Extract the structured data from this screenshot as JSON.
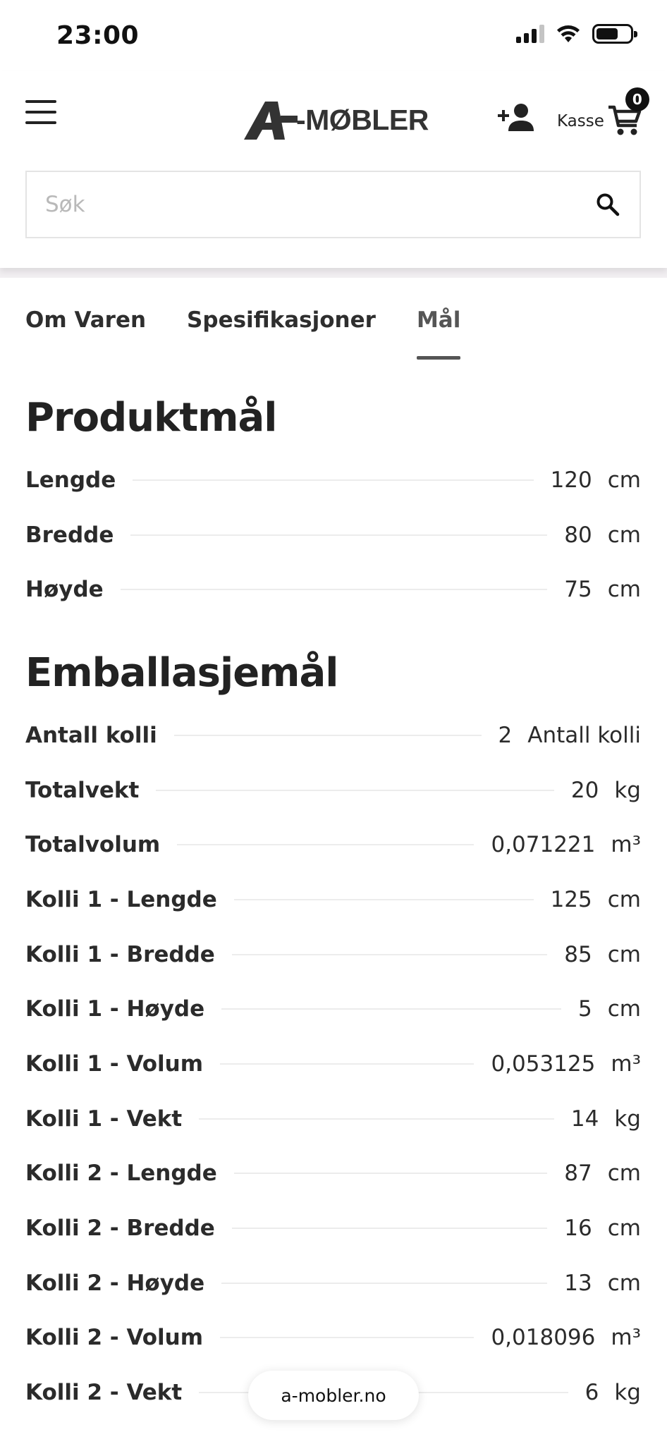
{
  "status_bar": {
    "time": "23:00"
  },
  "header": {
    "logo_text": "-MØBLER",
    "kasse_label": "Kasse",
    "cart_count": "0"
  },
  "search": {
    "placeholder": "Søk"
  },
  "tabs": [
    {
      "label": "Om Varen"
    },
    {
      "label": "Spesifikasjoner"
    },
    {
      "label": "Mål"
    }
  ],
  "active_tab": "Mål",
  "product_dimensions": {
    "title": "Produktmål",
    "rows": [
      {
        "label": "Lengde",
        "value": "120",
        "unit": "cm"
      },
      {
        "label": "Bredde",
        "value": "80",
        "unit": "cm"
      },
      {
        "label": "Høyde",
        "value": "75",
        "unit": "cm"
      }
    ]
  },
  "package_dimensions": {
    "title": "Emballasjemål",
    "rows": [
      {
        "label": "Antall kolli",
        "value": "2",
        "unit": "Antall kolli"
      },
      {
        "label": "Totalvekt",
        "value": "20",
        "unit": "kg"
      },
      {
        "label": "Totalvolum",
        "value": "0,071221",
        "unit": "m³"
      },
      {
        "label": "Kolli 1 - Lengde",
        "value": "125",
        "unit": "cm"
      },
      {
        "label": "Kolli 1 - Bredde",
        "value": "85",
        "unit": "cm"
      },
      {
        "label": "Kolli 1 - Høyde",
        "value": "5",
        "unit": "cm"
      },
      {
        "label": "Kolli 1 - Volum",
        "value": "0,053125",
        "unit": "m³"
      },
      {
        "label": "Kolli 1 - Vekt",
        "value": "14",
        "unit": "kg"
      },
      {
        "label": "Kolli 2 - Lengde",
        "value": "87",
        "unit": "cm"
      },
      {
        "label": "Kolli 2 - Bredde",
        "value": "16",
        "unit": "cm"
      },
      {
        "label": "Kolli 2 - Høyde",
        "value": "13",
        "unit": "cm"
      },
      {
        "label": "Kolli 2 - Volum",
        "value": "0,018096",
        "unit": "m³"
      },
      {
        "label": "Kolli 2 - Vekt",
        "value": "6",
        "unit": "kg"
      }
    ]
  },
  "browser": {
    "url": "a-mobler.no"
  }
}
